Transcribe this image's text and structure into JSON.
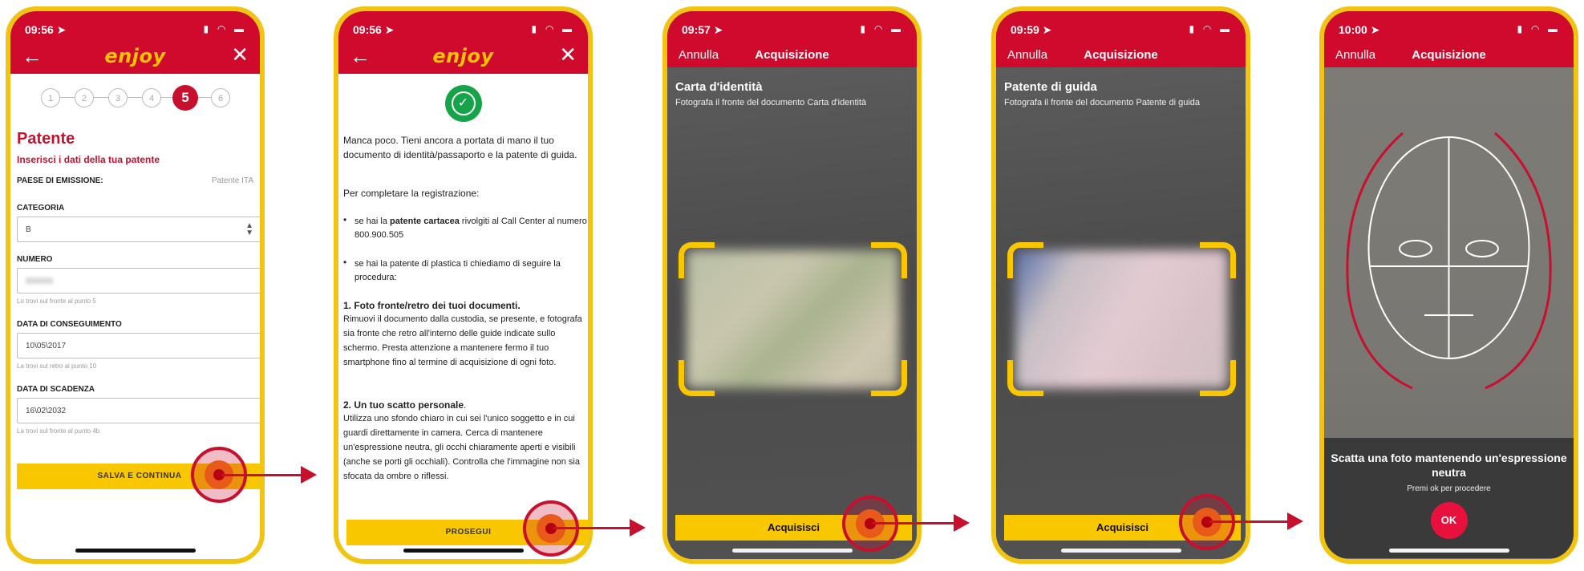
{
  "status_bar": {
    "times": [
      "09:56",
      "09:56",
      "09:57",
      "09:59",
      "10:00"
    ],
    "location_icon": "location-arrow-icon",
    "signal_icons": "signal-wifi-battery-icons"
  },
  "screen1": {
    "logo": "enjoy",
    "steps": [
      "1",
      "2",
      "3",
      "4",
      "5",
      "6"
    ],
    "active_step": "5",
    "title": "Patente",
    "subtitle": "Inserisci i dati della tua patente",
    "country_label": "PAESE DI EMISSIONE:",
    "country_value": "Patente ITA",
    "category_label": "CATEGORIA",
    "category_value": "B",
    "number_label": "NUMERO",
    "number_hint": "Lo trovi sul fronte al punto 5",
    "issue_label": "DATA DI CONSEGUIMENTO",
    "issue_value": "10\\05\\2017",
    "issue_hint": "La trovi sul retro al punto 10",
    "expiry_label": "DATA DI SCADENZA",
    "expiry_value": "16\\02\\2032",
    "expiry_hint": "La trovi sul fronte al punto 4b",
    "save_button": "SALVA E CONTINUA"
  },
  "screen2": {
    "logo": "enjoy",
    "intro": "Manca poco. Tieni ancora a portata di mano il tuo documento di identità/passaporto e la patente di guida.",
    "complete_label": "Per completare la registrazione:",
    "bullet1_pre": "se hai la ",
    "bullet1_bold": "patente cartacea",
    "bullet1_post": " rivolgiti al Call Center al numero 800.900.505",
    "bullet2": "se hai la patente di plastica ti chiediamo di seguire la procedura:",
    "section1_title": "1. Foto fronte/retro dei tuoi documenti.",
    "section1_text": "Rimuovi il documento dalla custodia, se presente, e fotografa sia fronte che retro all'interno delle guide indicate sullo schermo. Presta attenzione a mantenere fermo il tuo smartphone fino al termine di acquisizione di ogni foto.",
    "section2_title": "2. Un tuo scatto personale",
    "section2_text": "Utilizza uno sfondo chiaro in cui sei l'unico soggetto e in cui guardi direttamente in camera. Cerca di mantenere un'espressione neutra, gli occhi chiaramente aperti e visibili (anche se porti gli occhiali). Controlla che l'immagine non sia sfocata da ombre o riflessi.",
    "continue_button": "PROSEGUI"
  },
  "screen3": {
    "cancel": "Annulla",
    "title": "Acquisizione",
    "doc_type": "Carta d'identità",
    "instruction": "Fotografa il fronte del documento Carta d'identità",
    "capture_button": "Acquisisci"
  },
  "screen4": {
    "cancel": "Annulla",
    "title": "Acquisizione",
    "doc_type": "Patente di guida",
    "instruction": "Fotografa il fronte del documento Patente di guida",
    "capture_button": "Acquisisci"
  },
  "screen5": {
    "cancel": "Annulla",
    "title": "Acquisizione",
    "message": "Scatta una foto mantenendo un'espressione neutra",
    "sub_message": "Premi ok per procedere",
    "ok_button": "OK"
  },
  "colors": {
    "brand_red": "#cf0a2c",
    "accent_yellow": "#f9c700",
    "phone_frame": "#f2c412",
    "success_green": "#17a34a"
  }
}
